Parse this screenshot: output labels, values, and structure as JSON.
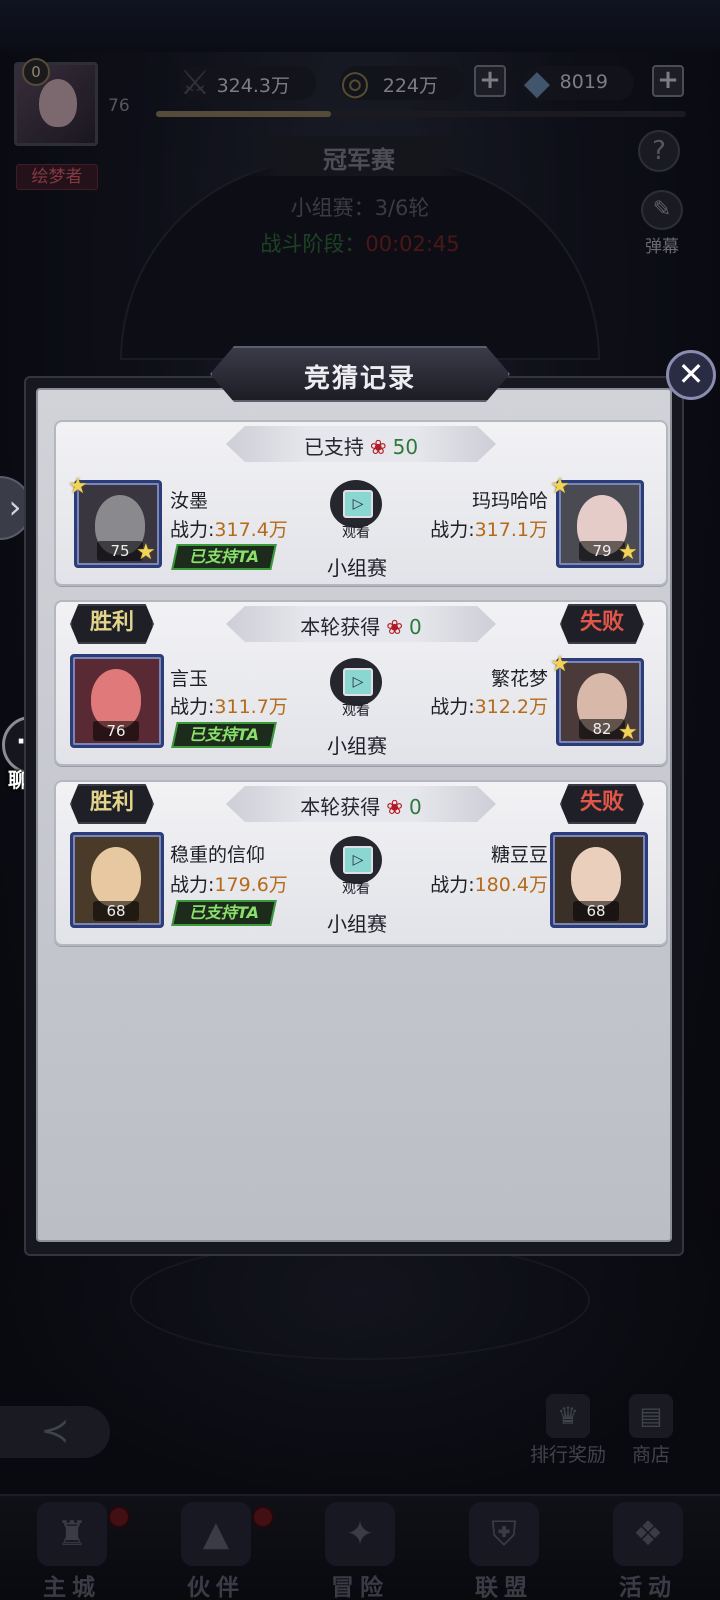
{
  "resources": {
    "power": "324.3万",
    "gold": "224万",
    "diamond": "8019",
    "power_icon": "sword-icon",
    "gold_icon": "coin-icon",
    "diamond_icon": "diamond-icon"
  },
  "player": {
    "vip": "0",
    "level": "76",
    "title": "绘梦者",
    "exp_progress": 0.33
  },
  "background": {
    "title": "冠军赛",
    "round_info": "小组赛：3/6轮",
    "phase_label": "战斗阶段：",
    "phase_time": "00:02:45",
    "danmu_label": "弹幕",
    "help_icon": "?",
    "rank_reward": "排行奖励",
    "shop": "商店"
  },
  "chat": {
    "label": "聊天",
    "icon": "chat-bubble-icon"
  },
  "modal": {
    "title": "竞猜记录",
    "close_icon": "✕"
  },
  "records": [
    {
      "banner_label": "已支持",
      "banner_value": "50",
      "left": {
        "name": "汝墨",
        "power_label": "战力:",
        "power": "317.4万",
        "level": "75",
        "supported": "已支持TA"
      },
      "right": {
        "name": "玛玛哈哈",
        "power_label": "战力:",
        "power": "317.1万",
        "level": "79"
      },
      "watch": "观看",
      "match_type": "小组赛"
    },
    {
      "banner_label": "本轮获得",
      "banner_value": "0",
      "left_result": "胜利",
      "right_result": "失败",
      "left": {
        "name": "言玉",
        "power_label": "战力:",
        "power": "311.7万",
        "level": "76",
        "supported": "已支持TA"
      },
      "right": {
        "name": "繁花梦",
        "power_label": "战力:",
        "power": "312.2万",
        "level": "82"
      },
      "watch": "观看",
      "match_type": "小组赛"
    },
    {
      "banner_label": "本轮获得",
      "banner_value": "0",
      "left_result": "胜利",
      "right_result": "失败",
      "left": {
        "name": "稳重的信仰",
        "power_label": "战力:",
        "power": "179.6万",
        "level": "68",
        "supported": "已支持TA"
      },
      "right": {
        "name": "糖豆豆",
        "power_label": "战力:",
        "power": "180.4万",
        "level": "68"
      },
      "watch": "观看",
      "match_type": "小组赛"
    }
  ],
  "nav": [
    {
      "label": "主城",
      "icon": "castle-icon",
      "badge": true
    },
    {
      "label": "伙伴",
      "icon": "witch-hat-icon",
      "badge": true
    },
    {
      "label": "冒险",
      "icon": "compass-icon",
      "badge": false
    },
    {
      "label": "联盟",
      "icon": "shield-icon",
      "badge": false
    },
    {
      "label": "活动",
      "icon": "cards-icon",
      "badge": false
    }
  ],
  "colors": {
    "power_value": "#b56a1a",
    "support_green": "#8ae06a",
    "win_gold": "#e3d48a",
    "lose_red": "#e0564a",
    "rose_red": "#b21a24"
  }
}
